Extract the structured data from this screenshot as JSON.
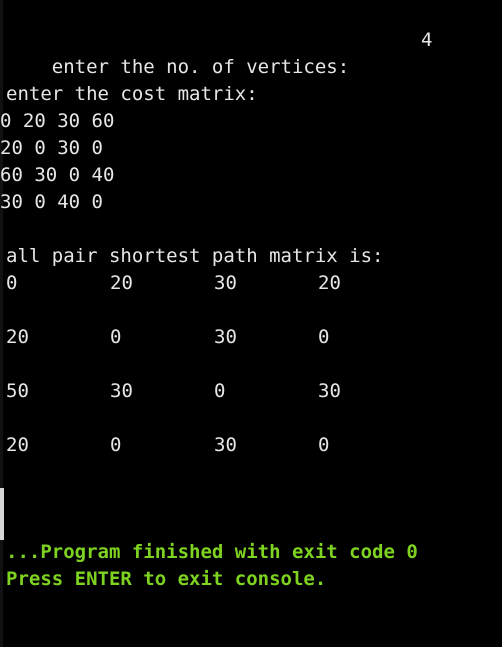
{
  "prompt_vertices": {
    "label": "enter the no. of vertices:",
    "value": "4"
  },
  "prompt_matrix": "enter the cost matrix:",
  "input_rows": [
    "0 20 30 60",
    "20 0 30 0",
    "60 30 0 40",
    "30 0 40 0"
  ],
  "result_title": "all pair shortest path matrix is:",
  "result_rows": [
    [
      "0",
      "20",
      "30",
      "20"
    ],
    [
      "20",
      "0",
      "30",
      "0"
    ],
    [
      "50",
      "30",
      "0",
      "30"
    ],
    [
      "20",
      "0",
      "30",
      "0"
    ]
  ],
  "status": {
    "finished": "...Program finished with exit code 0",
    "exit_hint": "Press ENTER to exit console."
  },
  "colors": {
    "background": "#000000",
    "text": "#e6e6e6",
    "status_green": "#7ed321"
  }
}
